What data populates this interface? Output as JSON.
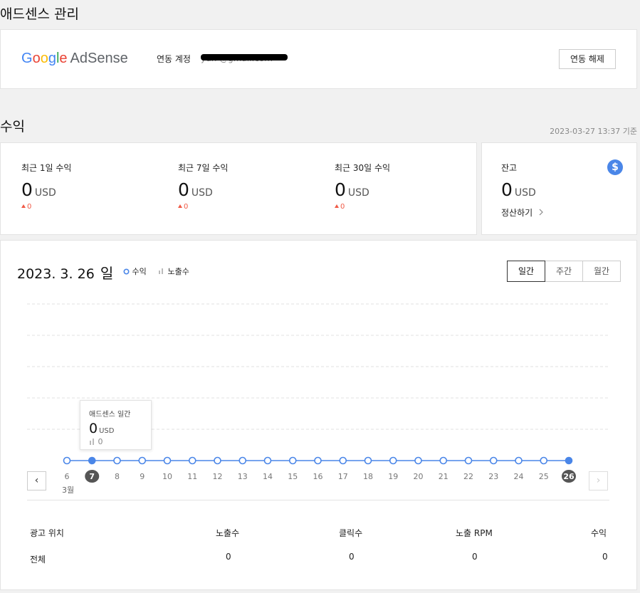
{
  "page_title": "애드센스 관리",
  "adsense": {
    "brand_google": "Google",
    "brand_adsense": "AdSense",
    "linked_label": "연동 계정",
    "linked_email": "yun     @gmail.com",
    "unlink_button": "연동 해제"
  },
  "revenue": {
    "section_title": "수익",
    "timestamp": "2023-03-27 13:37 기준",
    "stats": [
      {
        "label": "최근 1일 수익",
        "value": "0",
        "unit": "USD",
        "delta": "0"
      },
      {
        "label": "최근 7일 수익",
        "value": "0",
        "unit": "USD",
        "delta": "0"
      },
      {
        "label": "최근 30일 수익",
        "value": "0",
        "unit": "USD",
        "delta": "0"
      }
    ],
    "balance": {
      "label": "잔고",
      "value": "0",
      "unit": "USD",
      "settle_label": "정산하기",
      "icon": "dollar-icon",
      "icon_glyph": "$"
    }
  },
  "chart_panel": {
    "date": "2023. 3. 26",
    "day_of_week": "일",
    "legend_revenue": "수익",
    "legend_impressions": "노출수",
    "tabs": [
      "일간",
      "주간",
      "월간"
    ],
    "active_tab": "일간",
    "month_label": "3월",
    "tooltip": {
      "title": "애드센스 일간",
      "value": "0",
      "unit": "USD",
      "impressions": "0"
    },
    "prev_glyph": "‹",
    "next_glyph": "›"
  },
  "chart_data": {
    "type": "line",
    "x": [
      "6",
      "7",
      "8",
      "9",
      "10",
      "11",
      "12",
      "13",
      "14",
      "15",
      "16",
      "17",
      "18",
      "19",
      "20",
      "21",
      "22",
      "23",
      "24",
      "25",
      "26"
    ],
    "series": [
      {
        "name": "수익",
        "values": [
          0,
          0,
          0,
          0,
          0,
          0,
          0,
          0,
          0,
          0,
          0,
          0,
          0,
          0,
          0,
          0,
          0,
          0,
          0,
          0,
          0
        ]
      }
    ],
    "selected_x": [
      "7",
      "26"
    ],
    "grid": true,
    "colors": {
      "line": "#4a86e8",
      "selected": "#555555"
    }
  },
  "table": {
    "headers": [
      "광고 위치",
      "노출수",
      "클릭수",
      "노출 RPM",
      "수익"
    ],
    "rows": [
      [
        "전체",
        "0",
        "0",
        "0",
        "0"
      ]
    ]
  }
}
